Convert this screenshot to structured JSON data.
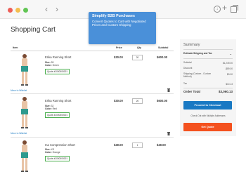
{
  "browser": {
    "back_icon": "chevron-left-icon",
    "forward_icon": "chevron-right-icon",
    "download_icon": "download-icon",
    "new_tab_icon": "plus-icon",
    "tabs_icon": "tabs-icon"
  },
  "tooltip": {
    "title": "Simplify B2B Purchases",
    "body": "Convert Quotes to Cart with Negotiated Prices and Custom Shipping"
  },
  "page": {
    "title": "Shopping Cart"
  },
  "table": {
    "headers": {
      "item": "Item",
      "price": "Price",
      "qty": "Qty",
      "subtotal": "Subtotal"
    },
    "wishlist_label": "Move to Wishlist",
    "rows": [
      {
        "name": "Erika Running Short",
        "size_label": "Size:",
        "size": "28",
        "color_label": "Color:",
        "color": "Green",
        "quote": "Quote #1000000001",
        "price": "$30.00",
        "qty": "20",
        "subtotal": "$600.00"
      },
      {
        "name": "Erika Running Short",
        "size_label": "Size:",
        "size": "32",
        "color_label": "Color:",
        "color": "Red",
        "quote": "Quote #1000000001",
        "price": "$30.00",
        "qty": "20",
        "subtotal": "$600.00"
      },
      {
        "name": "Ina Compression Short",
        "size_label": "Size:",
        "size": "XS",
        "color_label": "Color:",
        "color": "Orange",
        "quote": "Quote #1000000001",
        "price": "$49.00",
        "qty": "1",
        "subtotal": "$49.00"
      }
    ]
  },
  "summary": {
    "title": "Summary",
    "shipping_select": "Estimate Shipping and Tax",
    "lines": [
      {
        "label": "Subtotal",
        "value": "$1,249.00"
      },
      {
        "label": "Discount",
        "value": "-$89.00"
      },
      {
        "label": "Shipping (Custom - Custom Method)",
        "value": "$0.00"
      },
      {
        "label": "Tax",
        "value": "$10.13"
      }
    ],
    "total_label": "Order Total",
    "total_value": "$3,060.13",
    "checkout_button": "Proceed to Checkout",
    "multi_address_link": "Check Out with Multiple Addresses",
    "quote_button": "Get Quote"
  },
  "colors": {
    "primary_blue": "#1979c3",
    "tooltip_blue": "#4a90d9",
    "quote_orange": "#f4511e",
    "quote_border_green": "#4caf50",
    "product_teal": "#2e9a8e"
  }
}
